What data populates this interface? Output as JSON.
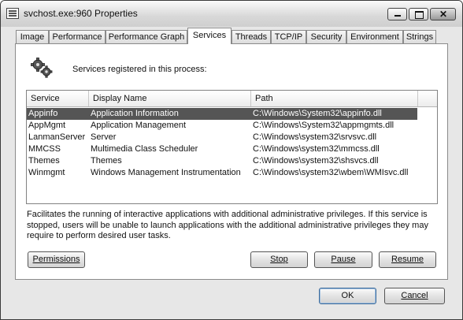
{
  "window": {
    "title": "svchost.exe:960 Properties"
  },
  "tabs": [
    {
      "label": "Image"
    },
    {
      "label": "Performance"
    },
    {
      "label": "Performance Graph"
    },
    {
      "label": "Services"
    },
    {
      "label": "Threads"
    },
    {
      "label": "TCP/IP"
    },
    {
      "label": "Security"
    },
    {
      "label": "Environment"
    },
    {
      "label": "Strings"
    }
  ],
  "services_panel": {
    "heading": "Services registered in this process:",
    "columns": [
      "Service",
      "Display Name",
      "Path"
    ],
    "rows": [
      {
        "service": "Appinfo",
        "display_name": "Application Information",
        "path": "C:\\Windows\\System32\\appinfo.dll"
      },
      {
        "service": "AppMgmt",
        "display_name": "Application Management",
        "path": "C:\\Windows\\System32\\appmgmts.dll"
      },
      {
        "service": "LanmanServer",
        "display_name": "Server",
        "path": "C:\\Windows\\system32\\srvsvc.dll"
      },
      {
        "service": "MMCSS",
        "display_name": "Multimedia Class Scheduler",
        "path": "C:\\Windows\\system32\\mmcss.dll"
      },
      {
        "service": "Themes",
        "display_name": "Themes",
        "path": "C:\\Windows\\system32\\shsvcs.dll"
      },
      {
        "service": "Winmgmt",
        "display_name": "Windows Management Instrumentation",
        "path": "C:\\Windows\\system32\\wbem\\WMIsvc.dll"
      }
    ],
    "selected_service": "Appinfo",
    "description": "Facilitates the running of interactive applications with additional administrative privileges.  If this service is stopped, users will be unable to launch applications with the additional administrative privileges they may require to perform desired user tasks.",
    "buttons": {
      "permissions": "Permissions",
      "stop": "Stop",
      "pause": "Pause",
      "resume": "Resume"
    }
  },
  "dialog_buttons": {
    "ok": "OK",
    "cancel": "Cancel"
  },
  "icons": {
    "app": "window-app-icon",
    "services": "gears-icon"
  }
}
